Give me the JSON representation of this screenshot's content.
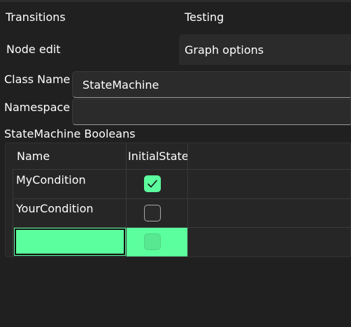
{
  "tabs": [
    {
      "label": "Transitions",
      "selected": false
    },
    {
      "label": "Testing",
      "selected": false
    },
    {
      "label": "Node edit",
      "selected": false
    },
    {
      "label": "Graph options",
      "selected": true
    }
  ],
  "form": {
    "class_name_label": "Class Name",
    "class_name_value": "StateMachine",
    "namespace_label": "Namespace",
    "namespace_value": ""
  },
  "booleans": {
    "title": "StateMachine Booleans",
    "columns": [
      "Name",
      "InitialState"
    ],
    "rows": [
      {
        "name": "MyCondition",
        "initial_state": true
      },
      {
        "name": "YourCondition",
        "initial_state": false
      }
    ],
    "new_row_name": ""
  },
  "colors": {
    "accent": "#5cff9d",
    "background": "#202020",
    "panel": "#2b2b2b"
  }
}
